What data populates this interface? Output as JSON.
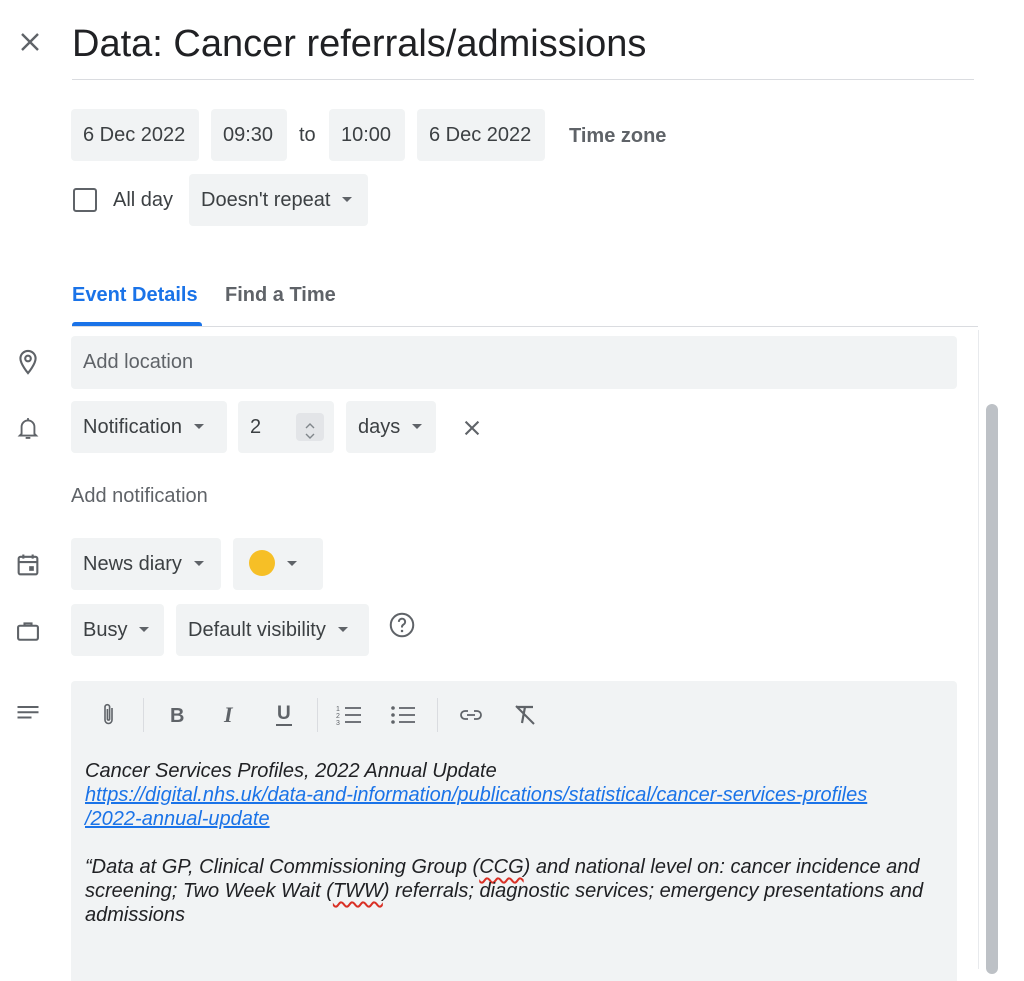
{
  "header": {
    "title": "Data: Cancer referrals/admissions"
  },
  "datetime": {
    "start_date": "6 Dec 2022",
    "start_time": "09:30",
    "to_label": "to",
    "end_time": "10:00",
    "end_date": "6 Dec 2022",
    "time_zone_label": "Time zone"
  },
  "all_day": {
    "label": "All day",
    "checked": false
  },
  "repeat": {
    "value": "Doesn't repeat"
  },
  "tabs": [
    {
      "label": "Event Details",
      "active": true
    },
    {
      "label": "Find a Time",
      "active": false
    }
  ],
  "location": {
    "placeholder": "Add location"
  },
  "notification": {
    "type": "Notification",
    "amount": "2",
    "unit": "days",
    "add_label": "Add notification"
  },
  "calendar": {
    "name": "News diary",
    "color": "#f6bf26"
  },
  "availability": {
    "status": "Busy",
    "visibility": "Default visibility"
  },
  "toolbar": {
    "icons": [
      "attach-icon",
      "bold-icon",
      "italic-icon",
      "underline-icon",
      "numbered-list-icon",
      "bulleted-list-icon",
      "link-icon",
      "clear-formatting-icon"
    ]
  },
  "description": {
    "line1": "Cancer Services Profiles, 2022 Annual Update",
    "link_part1": "https://digital.nhs.uk/data-and-information/publications/statistical/cancer-services-profiles",
    "link_part2": "/2022-annual-update",
    "quote_a": "“Data at GP, Clinical Commissioning Group (",
    "abbr_ccg": "CCG",
    "quote_b": ") and national level on: cancer incidence and screening; Two Week Wait (",
    "abbr_tww": "TWW",
    "quote_c": ") referrals; diagnostic services; emergency presentations and admissions"
  },
  "colors": {
    "accent": "#1a73e8",
    "field_bg": "#f1f3f4",
    "text": "#3c4043"
  }
}
